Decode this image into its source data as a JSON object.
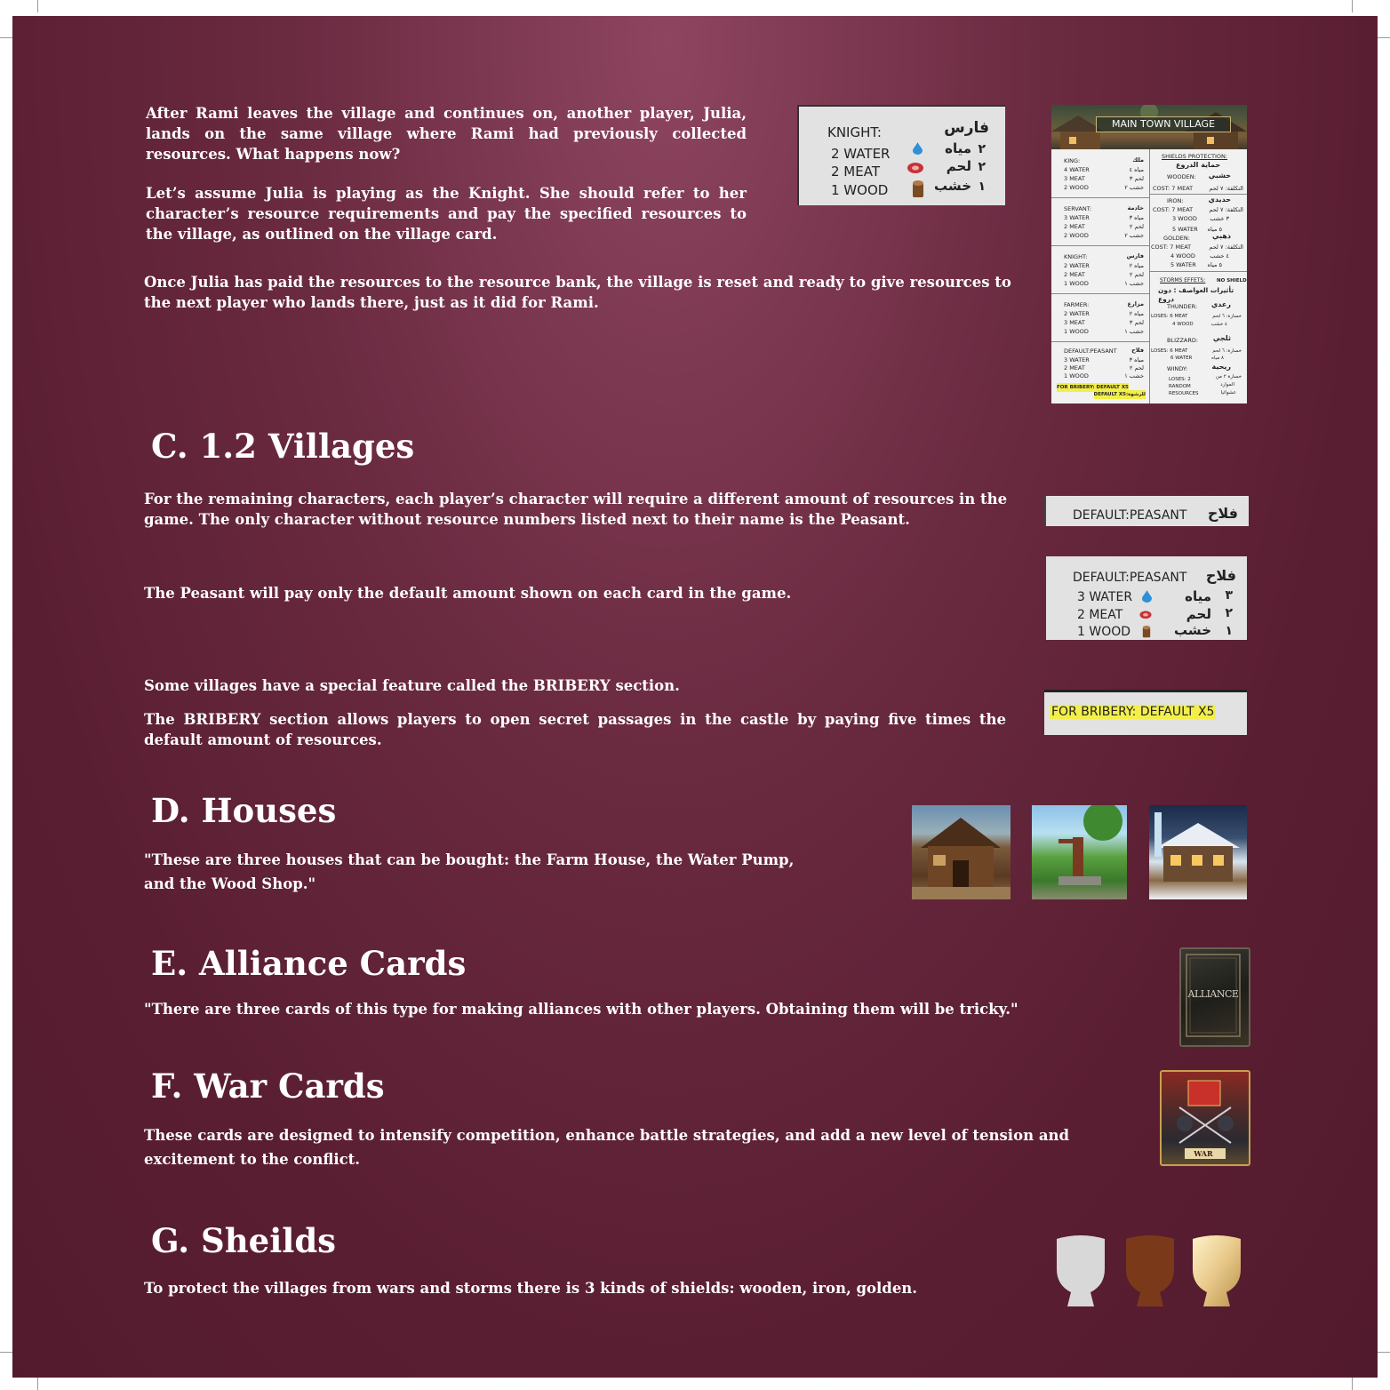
{
  "intro": {
    "p1": "After Rami leaves the village and continues on, another player, Julia, lands on the same village where Rami had previously collected resources. What happens now?",
    "p2": "Let’s assume Julia is playing as the Knight. She should refer to her character’s resource requirements and pay the specified resources to the village, as outlined on the village card.",
    "p3": "Once Julia has paid the resources to the resource bank, the village is reset and ready to give resources to the next player who lands there, just as it did for Rami."
  },
  "knight_card": {
    "title": "KNIGHT:",
    "title_ar": "فارس",
    "rows": [
      {
        "label": "2 WATER",
        "ar": "مياه",
        "num": "٢"
      },
      {
        "label": "2 MEAT",
        "ar": "لحم",
        "num": "٢"
      },
      {
        "label": "1 WOOD",
        "ar": "خشب",
        "num": "١"
      }
    ]
  },
  "village_card": {
    "title": "MAIN TOWN VILLAGE",
    "characters": [
      {
        "name": "KING:",
        "name_ar": "ملك",
        "lines": [
          "4 WATER",
          "3 MEAT",
          "2 WOOD"
        ],
        "ar": [
          "مياه ٤",
          "لحم ٣",
          "خشب ٢"
        ]
      },
      {
        "name": "SERVANT:",
        "name_ar": "خادمة",
        "lines": [
          "3 WATER",
          "2 MEAT",
          "2 WOOD"
        ],
        "ar": [
          "مياه ٣",
          "لحم ٢",
          "خشب ٢"
        ]
      },
      {
        "name": "KNIGHT:",
        "name_ar": "فارس",
        "lines": [
          "2 WATER",
          "2 MEAT",
          "1 WOOD"
        ],
        "ar": [
          "مياه ٢",
          "لحم ٢",
          "خشب ١"
        ]
      },
      {
        "name": "FARMER:",
        "name_ar": "مزارع",
        "lines": [
          "2 WATER",
          "3 MEAT",
          "1 WOOD"
        ],
        "ar": [
          "مياه ٢",
          "لحم ٣",
          "خشب ١"
        ]
      },
      {
        "name": "DEFAULT:PEASANT",
        "name_ar": "فلاح",
        "lines": [
          "3 WATER",
          "2 MEAT",
          "1 WOOD"
        ],
        "ar": [
          "مياه ٣",
          "لحم ٢",
          "خشب ١"
        ]
      }
    ],
    "bribery": "FOR BRIBERY: DEFAULT X5",
    "bribery2": "DEFAULT X5:للرشوة",
    "shields_title": "SHIELDS PROTECTION:",
    "shields_title_ar": "حماية الدروع",
    "wooden": "WOODEN:",
    "wooden_ar": "خشبي",
    "wooden_cost": "COST: 7 MEAT",
    "wooden_cost_ar": "التكلفة: ٧ لحم",
    "iron": "IRON:",
    "iron_ar": "حديدي",
    "iron_cost": [
      "COST: 7 MEAT",
      "3 WOOD",
      "5 WATER"
    ],
    "iron_cost_ar": [
      "التكلفة: ٧ لحم",
      "٣ خشب",
      "٥ مياه"
    ],
    "golden": "GOLDEN:",
    "golden_ar": "ذهبي",
    "golden_cost": [
      "COST: 7 MEAT",
      "4 WOOD",
      "5 WATER"
    ],
    "golden_cost_ar": [
      "التكلفة: ٧ لحم",
      "٤ خشب",
      "٥ مياه"
    ],
    "storms_title": "STORMS EFFETS:",
    "no_shield": "NO SHIELD",
    "storms_ar": "تأثيرات العواصف : دون دروع",
    "thunder": "THUNDER:",
    "thunder_ar": "رعدي",
    "thunder_loss": [
      "LOSES: 6  MEAT",
      "4 WOOD"
    ],
    "thunder_loss_ar": [
      "خسارة: ٦ لحم",
      "٤ خشب"
    ],
    "blizzard": "BLIZZARD:",
    "blizzard_ar": "ثلجي",
    "blizzard_loss": [
      "LOSES: 6 MEAT",
      "6 WATER"
    ],
    "blizzard_loss_ar": [
      "خسارة: ٦ لحم",
      "٨ مياه"
    ],
    "windy": "WINDY:",
    "windy_ar": "ريحية",
    "windy_loss": [
      "LOSES: 2",
      "RANDOM",
      "RESOURCES"
    ],
    "windy_loss_ar": [
      "خسارة ٢ من",
      "الموارد",
      "عشوائيا"
    ]
  },
  "villages": {
    "heading": "C. 1.2 Villages",
    "p1": "For the remaining characters, each player’s character will require a different amount of resources in the game. The only character without resource numbers listed next to their name is the Peasant.",
    "p2": "The Peasant will pay only the default amount shown on each card in the game.",
    "p3": "Some villages have a special feature called the BRIBERY section.",
    "p4": "The BRIBERY section allows players to open secret passages in the castle by paying five times the default amount of resources.",
    "peasant_label": "DEFAULT:PEASANT",
    "peasant_ar": "فلاح",
    "peasant_rows": [
      {
        "label": "3 WATER",
        "ar": "مياه",
        "num": "٣"
      },
      {
        "label": "2 MEAT",
        "ar": "لحم",
        "num": "٢"
      },
      {
        "label": "1 WOOD",
        "ar": "خشب",
        "num": "١"
      }
    ],
    "bribery_label": "FOR BRIBERY: DEFAULT X5"
  },
  "houses": {
    "heading": "D. Houses",
    "p": "\"These are three houses that can be bought: the Farm House, the Water Pump, and the Wood Shop.\""
  },
  "alliance": {
    "heading": "E. Alliance Cards",
    "p": "\"There are three cards of this type for making alliances with other players. Obtaining them will be tricky.\"",
    "card_label": "ALLIANCE"
  },
  "war": {
    "heading": "F. War Cards",
    "p": "These cards are designed to intensify competition, enhance battle strategies, and add a new level of tension and excitement to the conflict.",
    "card_label": "WAR"
  },
  "shields": {
    "heading": "G. Sheilds",
    "p": "To protect the villages from wars and storms there is 3 kinds of shields: wooden, iron, golden.",
    "colors": [
      "#d8d8d8",
      "#7a3a1a",
      "#e8c98a"
    ]
  }
}
